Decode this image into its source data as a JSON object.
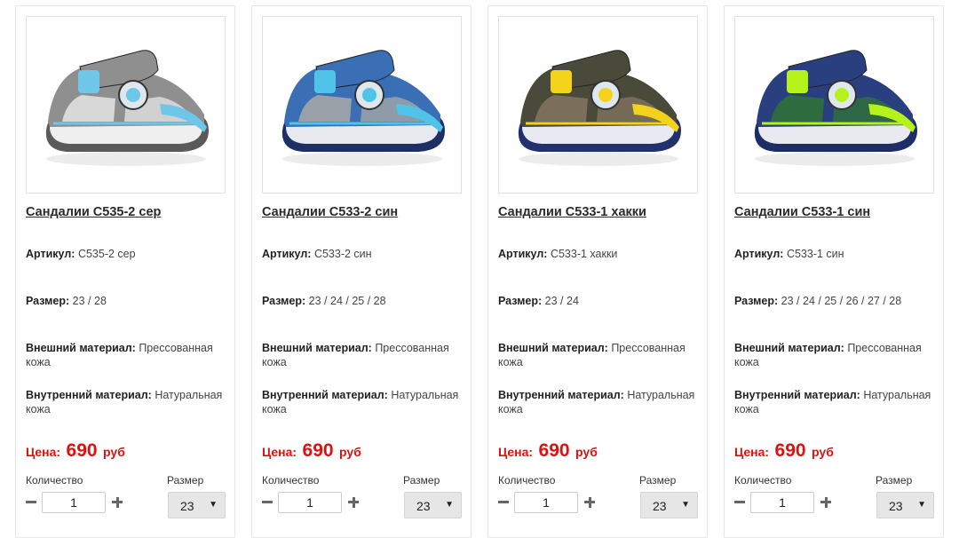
{
  "labels": {
    "sku": "Артикул:",
    "size": "Размер:",
    "outer": "Внешний материал:",
    "inner": "Внутренний материал:",
    "price": "Цена:",
    "currency": "руб",
    "quantity": "Количество",
    "size_select": "Размер"
  },
  "products": [
    {
      "title": "Сандалии С535-2 сер",
      "sku": "С535-2 сер",
      "sizes": "23 / 28",
      "outer": "Прессованная кожа",
      "inner": "Натуральная кожа",
      "price": "690",
      "quantity": "1",
      "selected_size": "23",
      "colors": {
        "upper": "#8f8f8f",
        "accent": "#6ec6e8",
        "sole": "#5a5a5a",
        "trim": "#d8d8d8"
      }
    },
    {
      "title": "Сандалии С533-2 син",
      "sku": "С533-2 син",
      "sizes": "23 / 24 / 25 / 28",
      "outer": "Прессованная кожа",
      "inner": "Натуральная кожа",
      "price": "690",
      "quantity": "1",
      "selected_size": "23",
      "colors": {
        "upper": "#3a6fb5",
        "accent": "#4fc3e8",
        "sole": "#1e2f66",
        "trim": "#9aa0a8"
      }
    },
    {
      "title": "Сандалии С533-1 хакки",
      "sku": "С533-1 хакки",
      "sizes": "23 / 24",
      "outer": "Прессованная кожа",
      "inner": "Натуральная кожа",
      "price": "690",
      "quantity": "1",
      "selected_size": "23",
      "colors": {
        "upper": "#4a4a3a",
        "accent": "#f2d21b",
        "sole": "#23306e",
        "trim": "#7b6f5b"
      }
    },
    {
      "title": "Сандалии С533-1 син",
      "sku": "С533-1 син",
      "sizes": "23 / 24 / 25 / 26 / 27 / 28",
      "outer": "Прессованная кожа",
      "inner": "Натуральная кожа",
      "price": "690",
      "quantity": "1",
      "selected_size": "23",
      "colors": {
        "upper": "#2a3f80",
        "accent": "#b5f21b",
        "sole": "#1f2d66",
        "trim": "#2e6b3e"
      }
    }
  ]
}
